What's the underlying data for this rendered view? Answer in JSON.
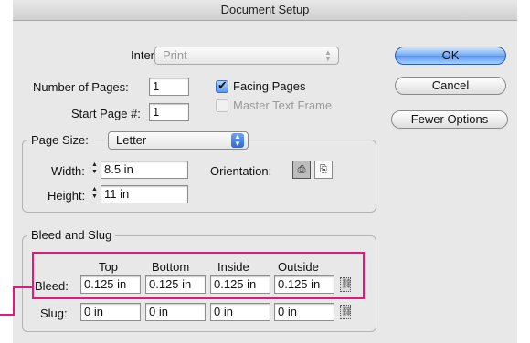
{
  "window": {
    "title": "Document Setup"
  },
  "intent": {
    "label": "Intent:",
    "value": "Print"
  },
  "pages": {
    "number_label": "Number of Pages:",
    "number_value": "1",
    "start_label": "Start Page #:",
    "start_value": "1",
    "facing_label": "Facing Pages",
    "facing_checked": true,
    "master_label": "Master Text Frame",
    "master_checked": false
  },
  "buttons": {
    "ok": "OK",
    "cancel": "Cancel",
    "fewer": "Fewer Options"
  },
  "page_size": {
    "label": "Page Size:",
    "value": "Letter",
    "width_label": "Width:",
    "width_value": "8.5 in",
    "height_label": "Height:",
    "height_value": "11 in",
    "orientation_label": "Orientation:",
    "orientation": "portrait"
  },
  "bleed_slug": {
    "group_label": "Bleed and Slug",
    "columns": [
      "Top",
      "Bottom",
      "Inside",
      "Outside"
    ],
    "bleed_label": "Bleed:",
    "bleed_values": [
      "0.125 in",
      "0.125 in",
      "0.125 in",
      "0.125 in"
    ],
    "slug_label": "Slug:",
    "slug_values": [
      "0 in",
      "0 in",
      "0 in",
      "0 in"
    ]
  },
  "colors": {
    "highlight": "#e0197d",
    "default_button": "#5796ef"
  }
}
